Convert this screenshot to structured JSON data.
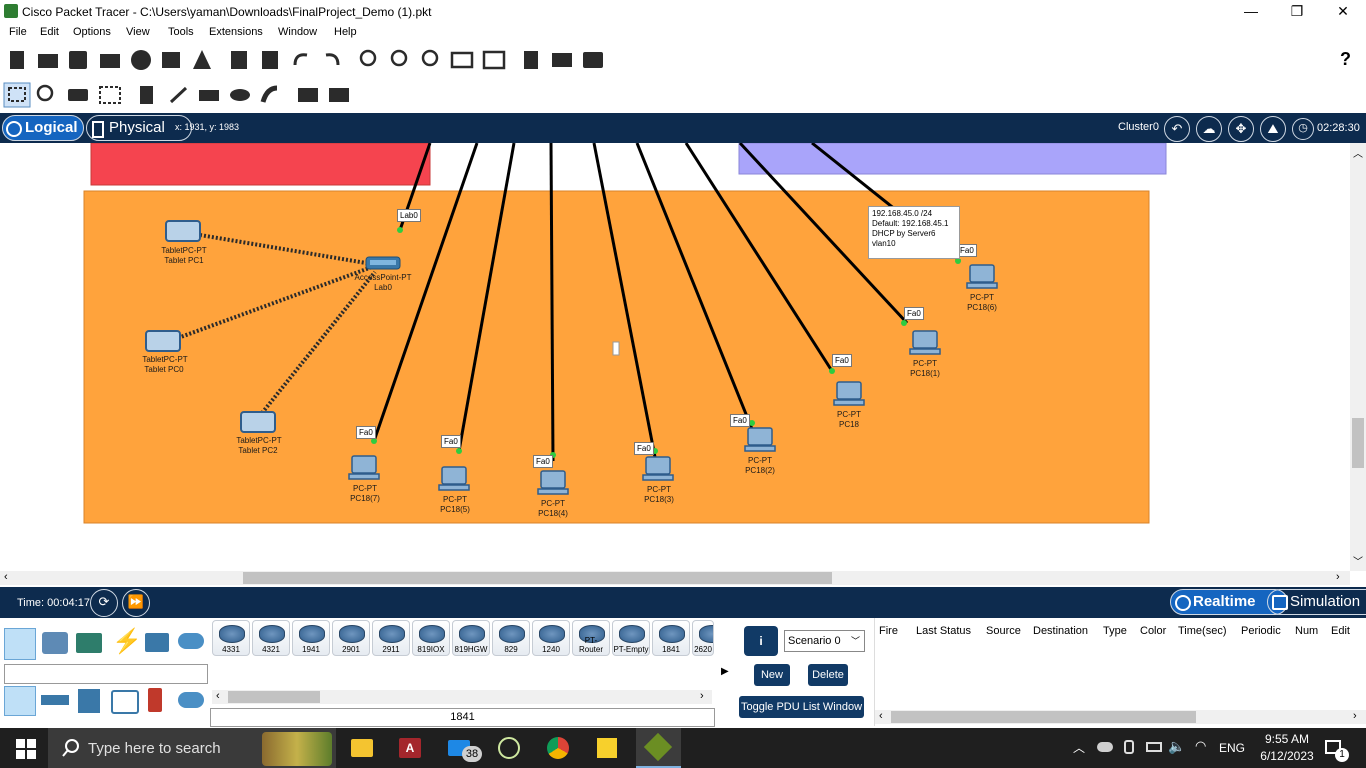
{
  "window": {
    "title": "Cisco Packet Tracer - C:\\Users\\yaman\\Downloads\\FinalProject_Demo (1).pkt",
    "minimize": "—",
    "maximize": "❐",
    "close": "✕"
  },
  "menu": [
    "File",
    "Edit",
    "Options",
    "View",
    "Tools",
    "Extensions",
    "Window",
    "Help"
  ],
  "help_icon": "?",
  "view_bar": {
    "logical": "Logical",
    "physical": "Physical",
    "coords": "x: 1931, y: 1983",
    "cluster": "Cluster0",
    "clock": "02:28:30"
  },
  "workspace": {
    "access_point": {
      "type": "AccessPoint-PT",
      "name": "Lab0",
      "port": "Lab0"
    },
    "tablets": [
      {
        "type": "TabletPC-PT",
        "name": "Tablet PC1"
      },
      {
        "type": "TabletPC-PT",
        "name": "Tablet PC0"
      },
      {
        "type": "TabletPC-PT",
        "name": "Tablet PC2"
      }
    ],
    "pcs": [
      {
        "type": "PC-PT",
        "name": "PC18(7)",
        "port": "Fa0"
      },
      {
        "type": "PC-PT",
        "name": "PC18(5)",
        "port": "Fa0"
      },
      {
        "type": "PC-PT",
        "name": "PC18(4)",
        "port": "Fa0"
      },
      {
        "type": "PC-PT",
        "name": "PC18(3)",
        "port": "Fa0"
      },
      {
        "type": "PC-PT",
        "name": "PC18(2)",
        "port": "Fa0"
      },
      {
        "type": "PC-PT",
        "name": "PC18",
        "port": "Fa0"
      },
      {
        "type": "PC-PT",
        "name": "PC18(1)",
        "port": "Fa0"
      },
      {
        "type": "PC-PT",
        "name": "PC18(6)",
        "port": "Fa0"
      }
    ],
    "note": {
      "line1": "192.168.45.0 /24",
      "line2": "Default: 192.168.45.1",
      "line3": "DHCP by Server6",
      "line4": "vlan10"
    },
    "colors": {
      "orange_area": "#ffa33c",
      "red_area": "#f5444f",
      "purple_area": "#a9a4fa"
    }
  },
  "time_bar": {
    "time": "Time: 00:04:17",
    "realtime": "Realtime",
    "simulation": "Simulation"
  },
  "device_panel": {
    "models": [
      "4331",
      "4321",
      "1941",
      "2901",
      "2911",
      "819IOX",
      "819HGW",
      "829",
      "1240",
      "PT-Router",
      "PT-Empty",
      "1841",
      "2620"
    ],
    "selected": "1841"
  },
  "pdu": {
    "scenario": "Scenario 0",
    "new": "New",
    "delete": "Delete",
    "toggle": "Toggle PDU List Window",
    "columns": [
      "Fire",
      "Last Status",
      "Source",
      "Destination",
      "Type",
      "Color",
      "Time(sec)",
      "Periodic",
      "Num",
      "Edit"
    ]
  },
  "taskbar": {
    "search": "Type here to search",
    "mail_badge": "38",
    "lang": "ENG",
    "time": "9:55 AM",
    "date": "6/12/2023",
    "notif": "1"
  }
}
